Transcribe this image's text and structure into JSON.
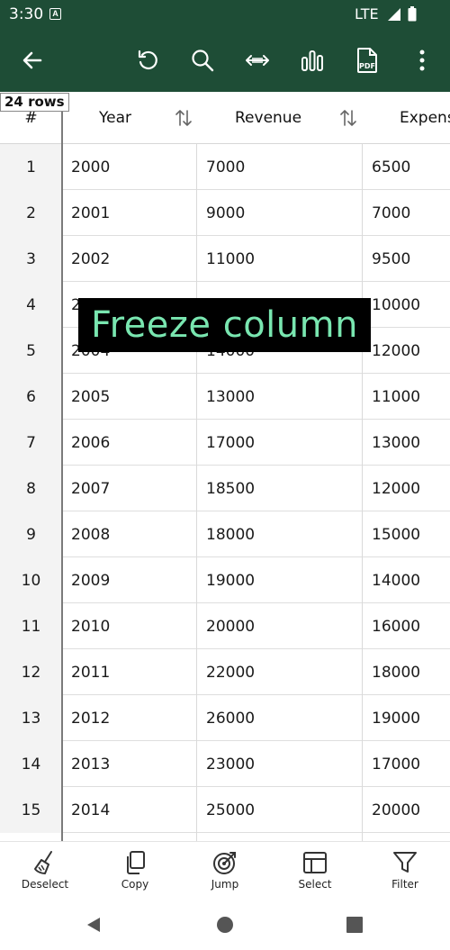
{
  "status_bar": {
    "time": "3:30",
    "network": "LTE"
  },
  "toolbar": {
    "icons": [
      "back-icon",
      "undo-icon",
      "search-icon",
      "fit-width-icon",
      "chart-icon",
      "pdf-icon",
      "more-icon"
    ],
    "pdf_text": "PDF",
    "background": "#1e4d36"
  },
  "table": {
    "row_count_badge": "24 rows",
    "headers": {
      "index": "#",
      "year": "Year",
      "revenue": "Revenue",
      "expenses": "Expens"
    },
    "rows": [
      {
        "num": "1",
        "year": "2000",
        "revenue": "7000",
        "expenses": "6500"
      },
      {
        "num": "2",
        "year": "2001",
        "revenue": "9000",
        "expenses": "7000"
      },
      {
        "num": "3",
        "year": "2002",
        "revenue": "11000",
        "expenses": "9500"
      },
      {
        "num": "4",
        "year": "2",
        "revenue": "",
        "expenses": "10000"
      },
      {
        "num": "5",
        "year": "2004",
        "revenue": "14000",
        "expenses": "12000"
      },
      {
        "num": "6",
        "year": "2005",
        "revenue": "13000",
        "expenses": "11000"
      },
      {
        "num": "7",
        "year": "2006",
        "revenue": "17000",
        "expenses": "13000"
      },
      {
        "num": "8",
        "year": "2007",
        "revenue": "18500",
        "expenses": "12000"
      },
      {
        "num": "9",
        "year": "2008",
        "revenue": "18000",
        "expenses": "15000"
      },
      {
        "num": "10",
        "year": "2009",
        "revenue": "19000",
        "expenses": "14000"
      },
      {
        "num": "11",
        "year": "2010",
        "revenue": "20000",
        "expenses": "16000"
      },
      {
        "num": "12",
        "year": "2011",
        "revenue": "22000",
        "expenses": "18000"
      },
      {
        "num": "13",
        "year": "2012",
        "revenue": "26000",
        "expenses": "19000"
      },
      {
        "num": "14",
        "year": "2013",
        "revenue": "23000",
        "expenses": "17000"
      },
      {
        "num": "15",
        "year": "2014",
        "revenue": "25000",
        "expenses": "20000"
      }
    ]
  },
  "overlay": {
    "caption": "Freeze column",
    "text_color": "#79e6b0"
  },
  "actions": [
    {
      "label": "Deselect",
      "icon": "broom-icon"
    },
    {
      "label": "Copy",
      "icon": "copy-icon"
    },
    {
      "label": "Jump",
      "icon": "target-icon"
    },
    {
      "label": "Select",
      "icon": "select-icon"
    },
    {
      "label": "Filter",
      "icon": "filter-icon"
    }
  ]
}
